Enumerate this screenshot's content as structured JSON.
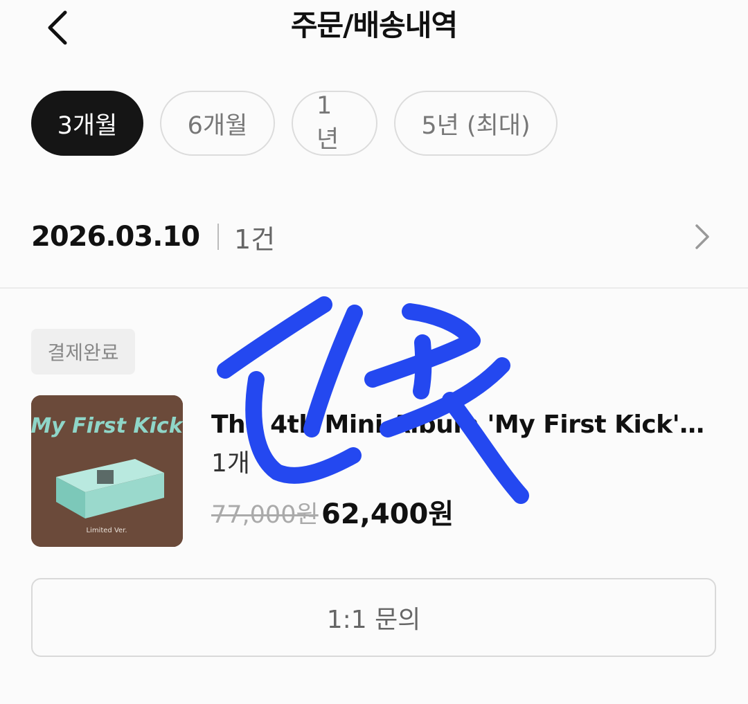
{
  "header": {
    "title": "주문/배송내역",
    "back_icon": "chevron-left-icon"
  },
  "filters": [
    {
      "label": "3개월",
      "active": true
    },
    {
      "label": "6개월",
      "active": false
    },
    {
      "label": "1년",
      "active": false
    },
    {
      "label": "5년 (최대)",
      "active": false
    }
  ],
  "order_group": {
    "date": "2026.03.10",
    "count": "1건",
    "chevron_icon": "chevron-right-icon"
  },
  "order_item": {
    "status": "결제완료",
    "thumbnail_title": "My First Kick",
    "thumbnail_caption": "Limited Ver.",
    "product_name": "The 4th Mini Album 'My First Kick' (Li...",
    "quantity": "1개",
    "original_price": "77,000원",
    "sale_price": "62,400원"
  },
  "inquiry_button": {
    "label": "1:1 문의"
  },
  "overlay": {
    "annotation_color": "#2448f0"
  },
  "colors": {
    "active_chip_bg": "#151515",
    "thumbnail_bg": "#6b4a3a",
    "thumbnail_accent": "#8fd6c8"
  }
}
